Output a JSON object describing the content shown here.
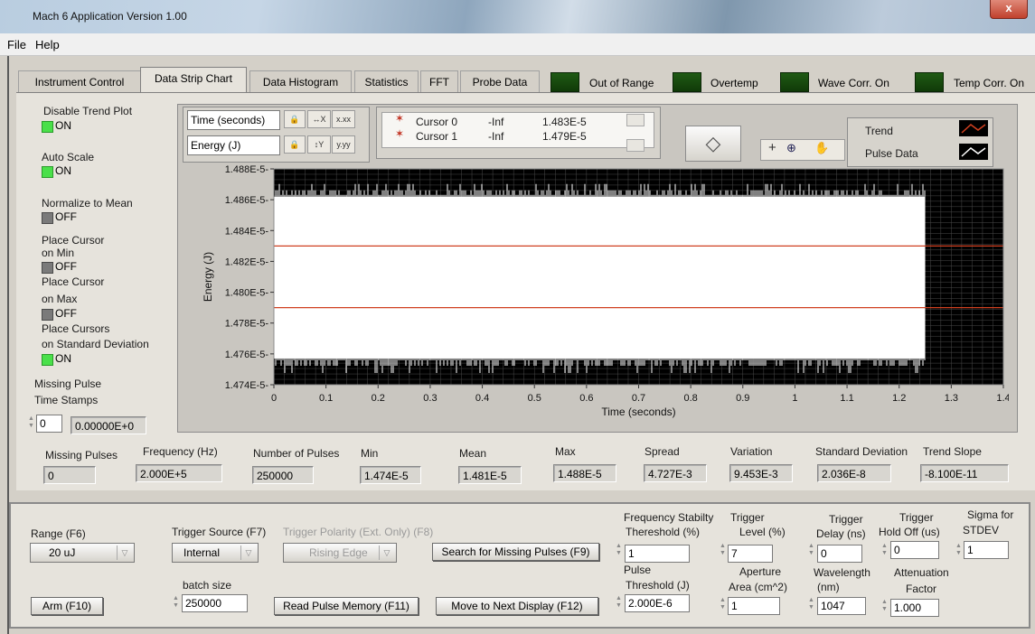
{
  "window": {
    "title": "Mach 6 Application Version 1.00",
    "close_glyph": "x"
  },
  "menu": [
    "File",
    "Help"
  ],
  "tabs": [
    "Instrument Control",
    "Data Strip Chart",
    "Data Histogram",
    "Statistics",
    "FFT",
    "Probe Data"
  ],
  "selected_tab": "Data Strip Chart",
  "status_leds": [
    "Out of Range",
    "Overtemp",
    "Wave Corr. On",
    "Temp Corr. On"
  ],
  "left_controls": {
    "disable_trend": {
      "label": "Disable Trend Plot",
      "state": "ON"
    },
    "auto_scale": {
      "label": "Auto Scale",
      "state": "ON"
    },
    "normalize": {
      "label": "Normalize to Mean",
      "state": "OFF"
    },
    "cursor_min": {
      "label1": "Place Cursor",
      "label2": "on Min",
      "state": "OFF"
    },
    "cursor_max": {
      "label1": "Place Cursor",
      "label2": "on Max",
      "state": "OFF"
    },
    "cursor_std": {
      "label1": "Place Cursors",
      "label2": "on Standard Deviation",
      "state": "ON"
    },
    "missing_ts": {
      "label1": "Missing Pulse",
      "label2": "Time Stamps",
      "index": "0",
      "value": "0.00000E+0"
    }
  },
  "scale_legend": {
    "x_name": "Time (seconds)",
    "y_name": "Energy (J)"
  },
  "cursor_legend": {
    "rows": [
      {
        "name": "Cursor 0",
        "x": "-Inf",
        "y": "1.483E-5"
      },
      {
        "name": "Cursor 1",
        "x": "-Inf",
        "y": "1.479E-5"
      }
    ]
  },
  "plot_legend": [
    "Trend",
    "Pulse Data"
  ],
  "chart_data": {
    "type": "line",
    "xlabel": "Time (seconds)",
    "ylabel": "Energy (J)",
    "xlim": [
      0,
      1.4
    ],
    "ylim": [
      1.474e-05,
      1.488e-05
    ],
    "x_ticks": [
      "0",
      "0.1",
      "0.2",
      "0.3",
      "0.4",
      "0.5",
      "0.6",
      "0.7",
      "0.8",
      "0.9",
      "1",
      "1.1",
      "1.2",
      "1.3",
      "1.4"
    ],
    "y_ticks": [
      "1.474E-5",
      "1.476E-5",
      "1.478E-5",
      "1.480E-5",
      "1.482E-5",
      "1.484E-5",
      "1.486E-5",
      "1.488E-5"
    ],
    "data_x_max": 1.25,
    "series_names": [
      "Trend",
      "Pulse Data"
    ],
    "cursors": [
      1.483e-05,
      1.479e-05
    ],
    "colors": {
      "plot_bg": "#000000",
      "data": "#ffffff",
      "cursor": "#d04020",
      "grid": "#4a4a4a"
    }
  },
  "stats": {
    "labels": [
      "Missing Pulses",
      "Frequency (Hz)",
      "Number of Pulses",
      "Min",
      "Mean",
      "Max",
      "Spread",
      "Variation",
      "Standard Deviation",
      "Trend Slope"
    ],
    "values": [
      "0",
      "2.000E+5",
      "250000",
      "1.474E-5",
      "1.481E-5",
      "1.488E-5",
      "4.727E-3",
      "9.453E-3",
      "2.036E-8",
      "-8.100E-11"
    ]
  },
  "bottom": {
    "range": {
      "label": "Range (F6)",
      "value": "20 uJ"
    },
    "trigger_source": {
      "label": "Trigger Source (F7)",
      "value": "Internal"
    },
    "trigger_polarity": {
      "label": "Trigger Polarity (Ext. Only) (F8)",
      "value": "Rising Edge"
    },
    "search_button": "Search for Missing Pulses (F9)",
    "arm_button": "Arm (F10)",
    "batch": {
      "label": "batch size",
      "value": "250000"
    },
    "read_button": "Read Pulse Memory (F11)",
    "move_button": "Move to Next Display (F12)",
    "freq_stab": {
      "label1": "Frequency Stabilty",
      "label2": "Thereshold (%)",
      "value": "1"
    },
    "trigger_level": {
      "label1": "Trigger",
      "label2": "Level (%)",
      "value": "7"
    },
    "trigger_delay": {
      "label1": "Trigger",
      "label2": "Delay (ns)",
      "value": "0"
    },
    "holdoff": {
      "label1": "Trigger",
      "label2": "Hold Off (us)",
      "value": "0"
    },
    "sigma": {
      "label1": "Sigma for",
      "label2": "STDEV",
      "value": "1"
    },
    "pulse_thresh": {
      "label1": "Pulse",
      "label2": "Threshold (J)",
      "value": "2.000E-6"
    },
    "aperture": {
      "label1": "Aperture",
      "label2": "Area (cm^2)",
      "value": "1"
    },
    "wavelength": {
      "label1": "Wavelength",
      "label2": "(nm)",
      "value": "1047"
    },
    "attenuation": {
      "label1": "Attenuation",
      "label2": "Factor",
      "value": "1.000"
    }
  }
}
